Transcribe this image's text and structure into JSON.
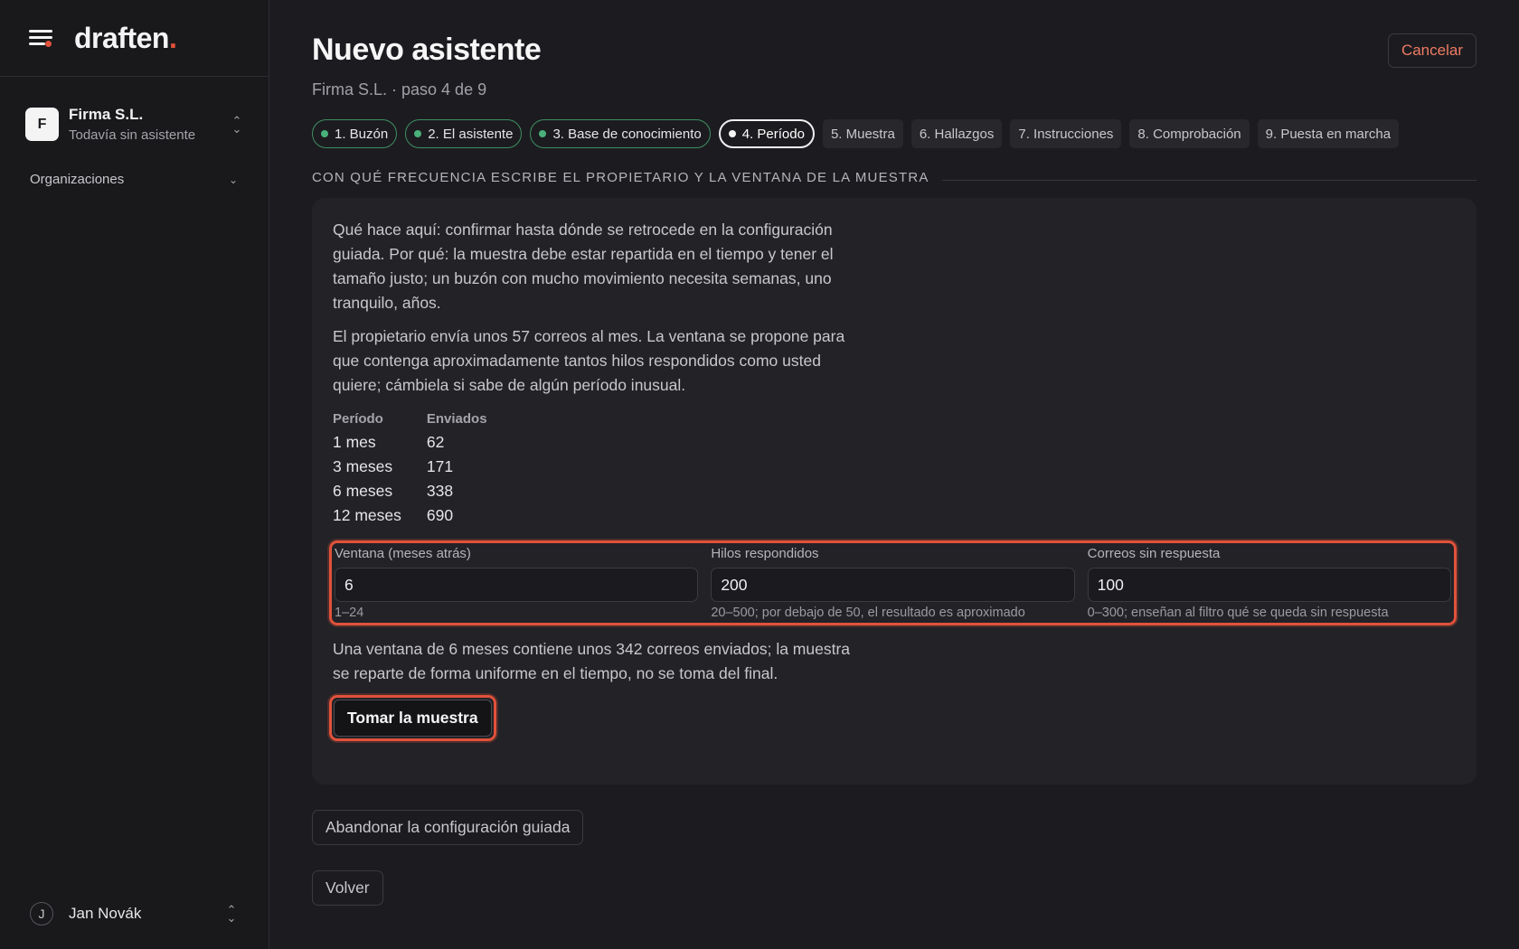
{
  "brand": {
    "name": "draften",
    "dot": "."
  },
  "org": {
    "initial": "F",
    "name": "Firma S.L.",
    "status": "Todavía sin asistente"
  },
  "sidebar": {
    "section_label": "Organizaciones"
  },
  "user": {
    "initial": "J",
    "name": "Jan Novák"
  },
  "header": {
    "title": "Nuevo asistente",
    "subtitle": "Firma S.L. · paso 4 de 9",
    "cancel_label": "Cancelar"
  },
  "steps": [
    {
      "label": "1. Buzón",
      "state": "done"
    },
    {
      "label": "2. El asistente",
      "state": "done"
    },
    {
      "label": "3. Base de conocimiento",
      "state": "done"
    },
    {
      "label": "4. Período",
      "state": "active"
    },
    {
      "label": "5. Muestra",
      "state": "todo"
    },
    {
      "label": "6. Hallazgos",
      "state": "todo"
    },
    {
      "label": "7. Instrucciones",
      "state": "todo"
    },
    {
      "label": "8. Comprobación",
      "state": "todo"
    },
    {
      "label": "9. Puesta en marcha",
      "state": "todo"
    }
  ],
  "section": {
    "title": "CON QUÉ FRECUENCIA ESCRIBE EL PROPIETARIO Y LA VENTANA DE LA MUESTRA",
    "intro": "Qué hace aquí: confirmar hasta dónde se retrocede en la configuración guiada. Por qué: la muestra debe estar repartida en el tiempo y tener el tamaño justo; un buzón con mucho movimiento necesita semanas, uno tranquilo, años.",
    "stats": "El propietario envía unos 57 correos al mes. La ventana se propone para que contenga aproximadamente tantos hilos respondidos como usted quiere; cámbiela si sabe de algún período inusual.",
    "table": {
      "headers": [
        "Período",
        "Enviados"
      ],
      "rows": [
        [
          "1 mes",
          "62"
        ],
        [
          "3 meses",
          "171"
        ],
        [
          "6 meses",
          "338"
        ],
        [
          "12 meses",
          "690"
        ]
      ]
    },
    "fields": {
      "window": {
        "label": "Ventana (meses atrás)",
        "value": "6",
        "hint": "1–24"
      },
      "threads": {
        "label": "Hilos respondidos",
        "value": "200",
        "hint": "20–500; por debajo de 50, el resultado es aproximado"
      },
      "unanswered": {
        "label": "Correos sin respuesta",
        "value": "100",
        "hint": "0–300; enseñan al filtro qué se queda sin respuesta"
      }
    },
    "summary": "Una ventana de 6 meses contiene unos 342 correos enviados; la muestra se reparte de forma uniforme en el tiempo, no se toma del final.",
    "sample_button": "Tomar la muestra"
  },
  "actions": {
    "abandon_label": "Abandonar la configuración guiada",
    "back_label": "Volver"
  },
  "colors": {
    "accent": "#e0523a",
    "done": "#49b079",
    "background": "#1c1c20"
  },
  "icons": {
    "menu": "menu-icon",
    "org_switch": "chevron-updown-icon",
    "section": "chevron-down-icon"
  }
}
